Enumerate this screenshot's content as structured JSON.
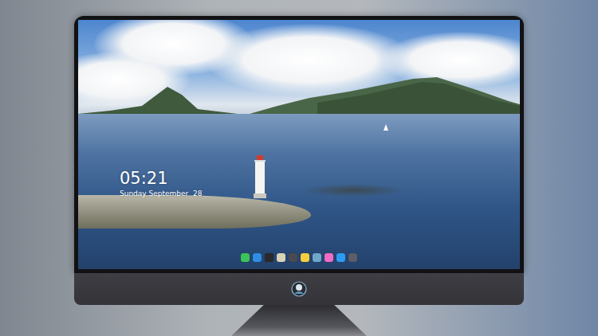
{
  "desktop": {
    "clock": {
      "time": "05:21",
      "date": "Sunday September  28"
    },
    "dock": {
      "items": [
        {
          "color": "#3cc35a"
        },
        {
          "color": "#2f8de4"
        },
        {
          "color": "#2a2a2e"
        },
        {
          "color": "#d9d2b8"
        },
        {
          "color": "#4a4a52"
        },
        {
          "color": "#f4d03f"
        },
        {
          "color": "#6fa7c9"
        },
        {
          "color": "#f06bc4"
        },
        {
          "color": "#2d9cf0"
        },
        {
          "color": "#5a5e66"
        }
      ]
    }
  }
}
